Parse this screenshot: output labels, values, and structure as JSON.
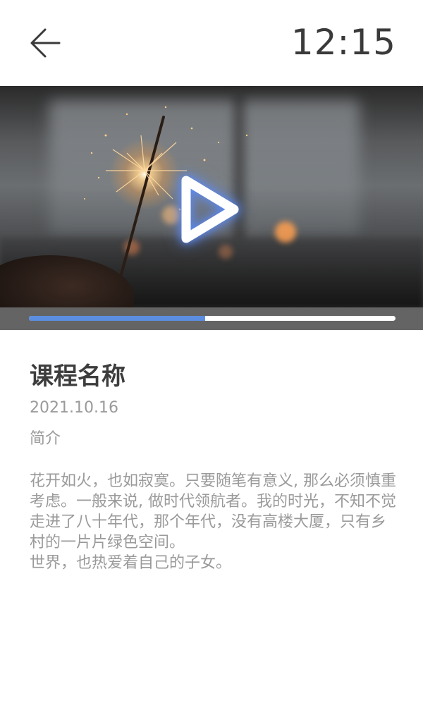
{
  "header": {
    "back_icon": "arrow-left-icon",
    "time": "12:15"
  },
  "player": {
    "play_icon": "play-icon",
    "progress": 0.48,
    "progress_color": "#5b8ee0",
    "track_color": "#ffffff",
    "strip_color": "#646464"
  },
  "course": {
    "title": "课程名称",
    "date": "2021.10.16",
    "intro_label": "简介",
    "intro_text": "花开如火，也如寂寞。只要随笔有意义, 那么必须慎重考虑。一般来说, 做时代领航者。我的时光，不知不觉走进了八十年代，那个年代，没有高楼大厦，只有乡村的一片片绿色空间。\n世界，也热爱着自己的子女。"
  }
}
